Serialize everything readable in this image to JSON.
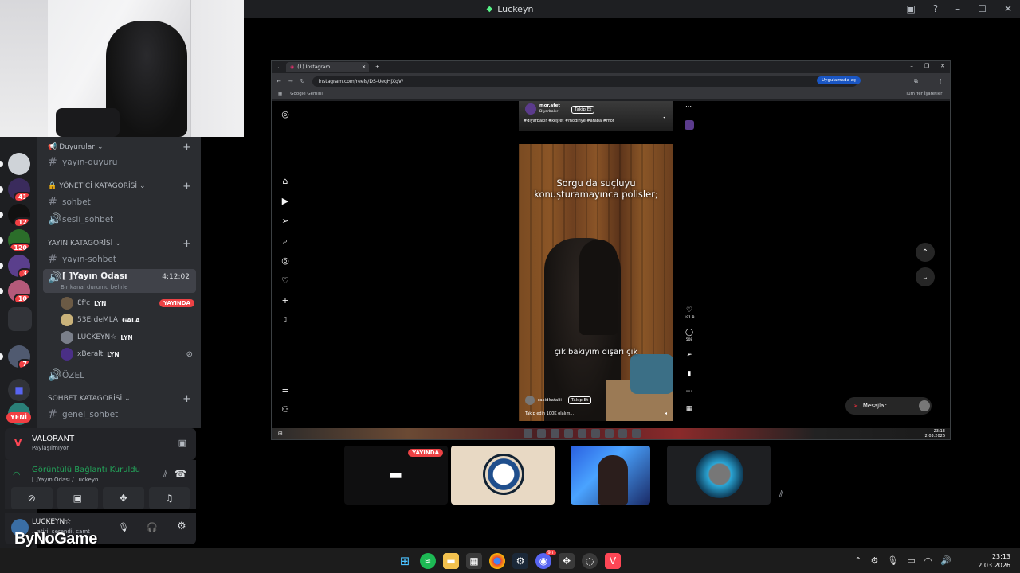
{
  "window": {
    "title": "Luckeyn"
  },
  "servers": [
    {
      "badge": "41"
    },
    {
      "badge": "12"
    },
    {
      "badge": "120"
    },
    {
      "badge": "3"
    },
    {
      "badge": "10"
    },
    {
      "badge": "7"
    }
  ],
  "new_label": "YENİ",
  "channels": {
    "cat_announcements": "Duyurular",
    "ch_stream_announce": "yayın-duyuru",
    "cat_admin": "YÖNETİCİ KATAGORİSİ",
    "ch_chat": "sohbet",
    "ch_voice_chat": "sesli_sohbet",
    "cat_stream": "YAYIN KATAGORİSİ",
    "ch_stream_chat": "yayın-sohbet",
    "ch_stream_room": "[  ]Yayın Odası",
    "ch_stream_room_timer": "4:12:02",
    "ch_stream_room_status": "Bir kanal durumu belirle",
    "voice_users": [
      {
        "name": "Ɛf'c",
        "tag": "LYN",
        "live": "YAYINDA"
      },
      {
        "name": "53ErdeMLA",
        "tag": "GALA"
      },
      {
        "name": "LUCKEYN☆",
        "tag": "LYN"
      },
      {
        "name": "xBeralt",
        "tag": "LYN"
      }
    ],
    "ch_private": "ÖZEL",
    "cat_chat": "SOHBET KATAGORİSİ",
    "ch_general_chat": "genel_sohbet"
  },
  "activity": {
    "game": "VALORANT",
    "status": "Paylaşılmıyor"
  },
  "voice_panel": {
    "status": "Görüntülü Bağlantı Kuruldu",
    "channel": "[  ]Yayın Odası / Luckeyn"
  },
  "user_panel": {
    "name": "LUCKEYN☆",
    "status": "...atiri, serendi, camt"
  },
  "watermark": "ByNoGame",
  "browser": {
    "tab_title": "(1) Instagram",
    "url": "instagram.com/reels/DS-UeqHjXgV/",
    "open_app": "Uygulamada aç",
    "bookmark": "Google Gemini",
    "bookmarks_right": "Tüm Yer İşaretleri"
  },
  "reel_prev": {
    "user": "mor.afet",
    "location": "Diyarbakır",
    "follow": "Takip Et",
    "hashtags": "#diyarbakır #keşfet #modifiye #araba #mor"
  },
  "reel": {
    "caption_top": "Sorgu da suçluyu konuşturamayınca polisler;",
    "caption_bottom": "çık bakıyım dışarı çık",
    "user": "rasidkafalii",
    "follow": "Takip Et",
    "desc": "Takip edin 100K olalım...",
    "likes": "191 B",
    "comments": "508"
  },
  "messages_label": "Mesajlar",
  "inner_clock": {
    "time": "23:13",
    "date": "2.03.2026"
  },
  "tile_live": "YAYINDA",
  "clock": {
    "time": "23:13",
    "date": "2.03.2026"
  },
  "taskbar_badge": "9+"
}
